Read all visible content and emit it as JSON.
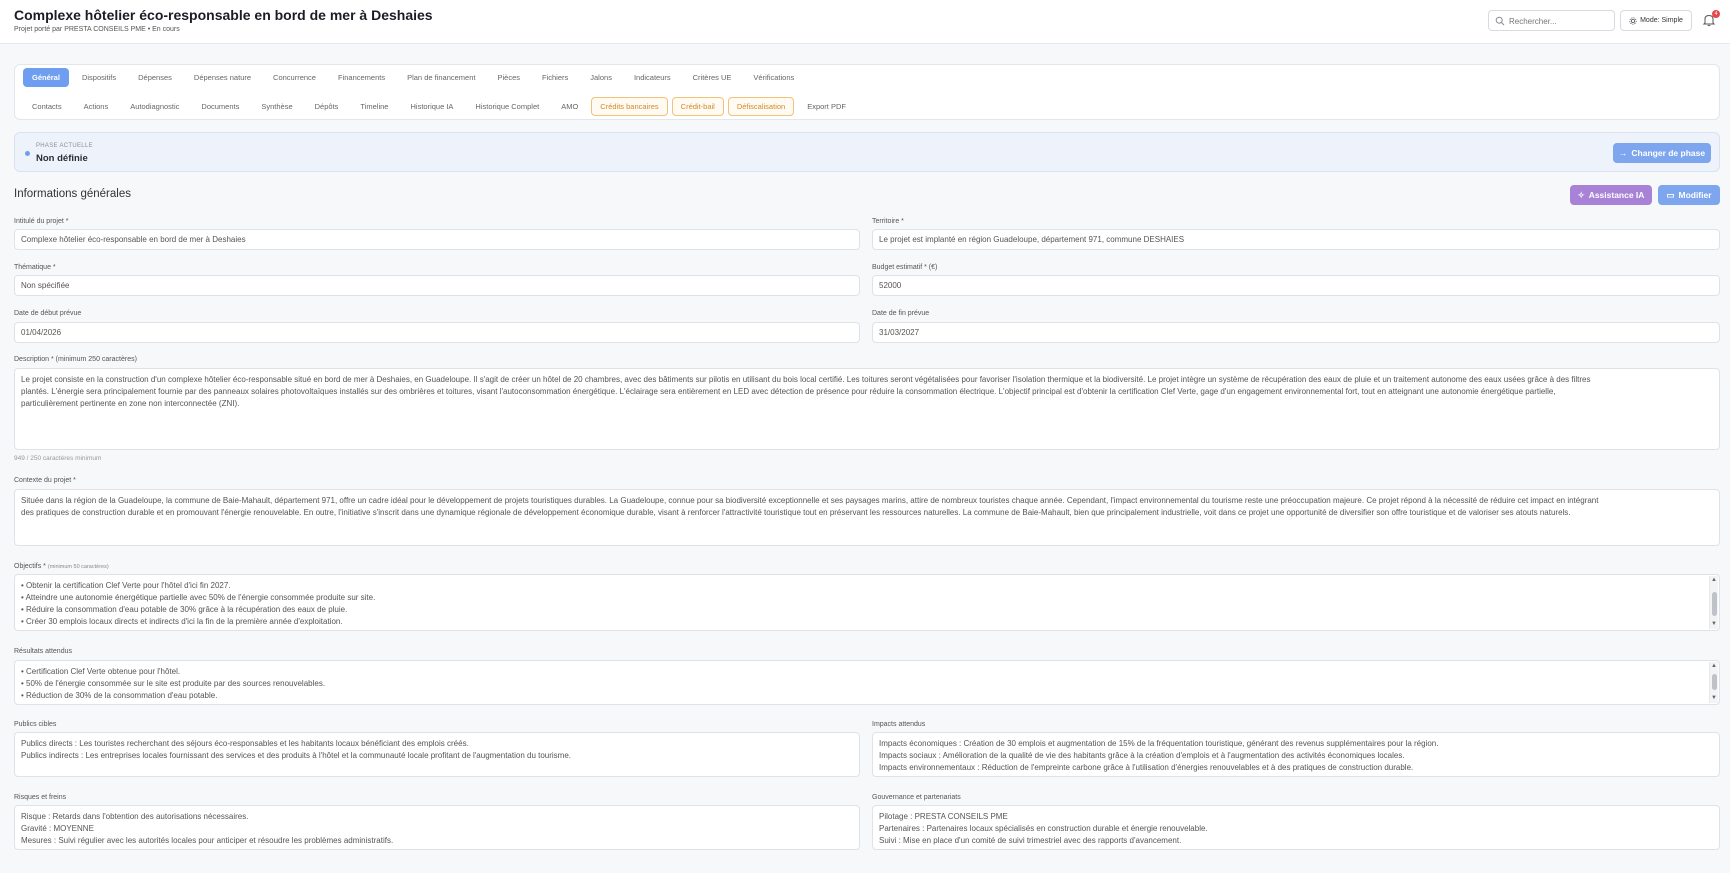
{
  "header": {
    "title": "Complexe hôtelier éco-responsable en bord de mer à Deshaies",
    "subtitle": "Projet porté par PRESTA CONSEILS PME • En cours",
    "search_placeholder": "Rechercher...",
    "mode_label": "Mode: Simple",
    "notification_count": "4"
  },
  "tabs": {
    "row1": [
      "Général",
      "Dispositifs",
      "Dépenses",
      "Dépenses nature",
      "Concurrence",
      "Financements",
      "Plan de financement",
      "Pièces",
      "Fichiers",
      "Jalons",
      "Indicateurs",
      "Critères UE",
      "Vérifications"
    ],
    "row2": [
      "Contacts",
      "Actions",
      "Autodiagnostic",
      "Documents",
      "Synthèse",
      "Dépôts",
      "Timeline",
      "Historique IA",
      "Historique Complet",
      "AMO",
      "Crédits bancaires",
      "Crédit-bail",
      "Défiscalisation",
      "Export PDF"
    ],
    "active": "Général",
    "highlighted": [
      "Crédits bancaires",
      "Crédit-bail",
      "Défiscalisation"
    ]
  },
  "phase": {
    "label": "PHASE ACTUELLE",
    "value": "Non définie",
    "button": "Changer de phase"
  },
  "section": {
    "title": "Informations générales",
    "ai_button": "Assistance IA",
    "edit_button": "Modifier"
  },
  "form": {
    "intitule": {
      "label": "Intitulé du projet *",
      "value": "Complexe hôtelier éco-responsable en bord de mer à Deshaies"
    },
    "territoire": {
      "label": "Territoire *",
      "value": "Le projet est implanté en région Guadeloupe, département 971, commune DESHAIES"
    },
    "thematique": {
      "label": "Thématique *",
      "value": "Non spécifiée"
    },
    "budget": {
      "label": "Budget estimatif * (€)",
      "value": "52000"
    },
    "date_debut": {
      "label": "Date de début prévue",
      "value": "01/04/2026"
    },
    "date_fin": {
      "label": "Date de fin prévue",
      "value": "31/03/2027"
    },
    "description": {
      "label": "Description * (minimum 250 caractères)",
      "lines": [
        "Le projet consiste en la construction d'un complexe hôtelier éco-responsable situé en bord de mer à Deshaies, en Guadeloupe. Il s'agit de créer un hôtel de 20 chambres, avec des bâtiments sur pilotis en utilisant du bois local certifié. Les toitures seront végétalisées pour favoriser l'isolation thermique et la biodiversité. Le projet intègre un système de récupération des eaux de pluie et un traitement autonome des eaux usées grâce à des filtres",
        "plantés. L'énergie sera principalement fournie par des panneaux solaires photovoltaïques installés sur des ombrières et toitures, visant l'autoconsommation énergétique. L'éclairage sera entièrement en LED avec détection de présence pour réduire la consommation électrique. L'objectif principal est d'obtenir la certification Clef Verte, gage d'un engagement environnemental fort, tout en atteignant une autonomie énergétique partielle,",
        "particulièrement pertinente en zone non interconnectée (ZNI)."
      ],
      "hint": "949 / 250 caractères minimum"
    },
    "contexte": {
      "label": "Contexte du projet *",
      "lines": [
        "Située dans la région de la Guadeloupe, la commune de Baie-Mahault, département 971, offre un cadre idéal pour le développement de projets touristiques durables. La Guadeloupe, connue pour sa biodiversité exceptionnelle et ses paysages marins, attire de nombreux touristes chaque année. Cependant, l'impact environnemental du tourisme reste une préoccupation majeure. Ce projet répond à la nécessité de réduire cet impact en intégrant",
        "des pratiques de construction durable et en promouvant l'énergie renouvelable. En outre, l'initiative s'inscrit dans une dynamique régionale de développement économique durable, visant à renforcer l'attractivité touristique tout en préservant les ressources naturelles. La commune de Baie-Mahault, bien que principalement industrielle, voit dans ce projet une opportunité de diversifier son offre touristique et de valoriser ses atouts naturels."
      ]
    },
    "objectifs": {
      "label": "Objectifs *",
      "label_note": "(minimum 50 caractères)",
      "lines": [
        "• Obtenir la certification Clef Verte pour l'hôtel d'ici fin 2027.",
        "• Atteindre une autonomie énergétique partielle avec 50% de l'énergie consommée produite sur site.",
        "• Réduire la consommation d'eau potable de 30% grâce à la récupération des eaux de pluie.",
        "• Créer 30 emplois locaux directs et indirects d'ici la fin de la première année d'exploitation."
      ]
    },
    "resultats": {
      "label": "Résultats attendus",
      "lines": [
        "• Certification Clef Verte obtenue pour l'hôtel.",
        "• 50% de l'énergie consommée sur le site est produite par des sources renouvelables.",
        "• Réduction de 30% de la consommation d'eau potable."
      ]
    },
    "publics": {
      "label": "Publics cibles",
      "lines": [
        "Publics directs : Les touristes recherchant des séjours éco-responsables et les habitants locaux bénéficiant des emplois créés.",
        "Publics indirects : Les entreprises locales fournissant des services et des produits à l'hôtel et la communauté locale profitant de l'augmentation du tourisme."
      ]
    },
    "impacts": {
      "label": "Impacts attendus",
      "lines": [
        "Impacts économiques : Création de 30 emplois et augmentation de 15% de la fréquentation touristique, générant des revenus supplémentaires pour la région.",
        "Impacts sociaux : Amélioration de la qualité de vie des habitants grâce à la création d'emplois et à l'augmentation des activités économiques locales.",
        "Impacts environnementaux : Réduction de l'empreinte carbone grâce à l'utilisation d'énergies renouvelables et à des pratiques de construction durable."
      ]
    },
    "risques": {
      "label": "Risques et freins",
      "lines": [
        "Risque : Retards dans l'obtention des autorisations nécessaires.",
        "Gravité : MOYENNE",
        "Mesures : Suivi régulier avec les autorités locales pour anticiper et résoudre les problèmes administratifs."
      ]
    },
    "gouvernance": {
      "label": "Gouvernance et partenariats",
      "lines": [
        "Pilotage : PRESTA CONSEILS PME",
        "Partenaires : Partenaires locaux spécialisés en construction durable et énergie renouvelable.",
        "Suivi : Mise en place d'un comité de suivi trimestriel avec des rapports d'avancement."
      ]
    }
  }
}
